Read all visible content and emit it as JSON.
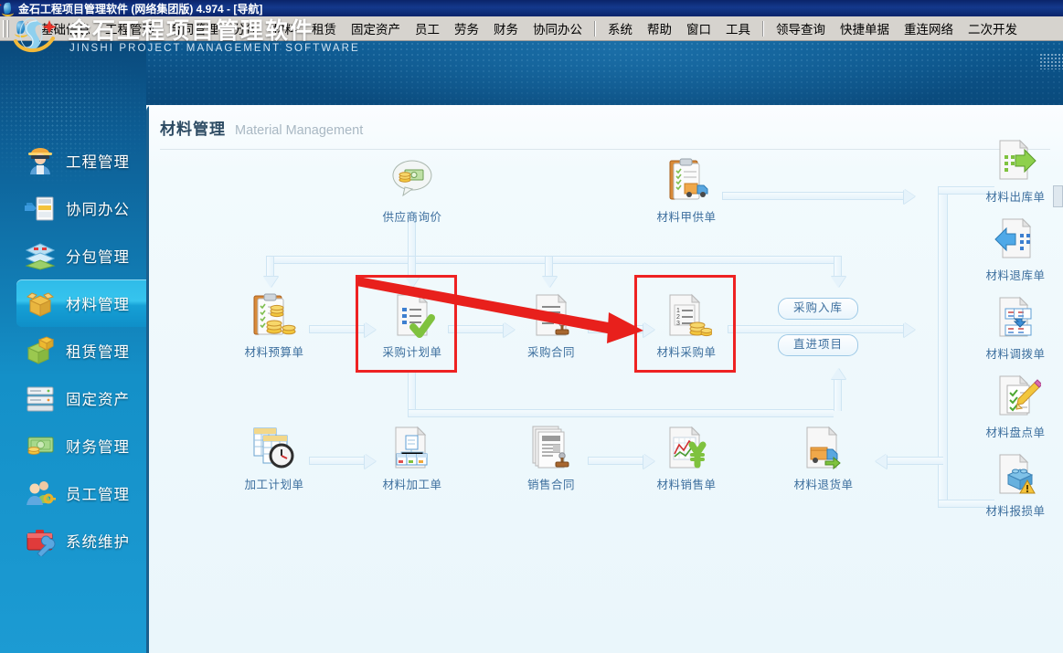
{
  "window": {
    "title": "金石工程项目管理软件 (网络集团版) 4.974 - [导航]",
    "icon": "app-logo-icon"
  },
  "menubar": {
    "items": [
      {
        "label": "基础信息"
      },
      {
        "label": "工程管理"
      },
      {
        "label": "合同管理"
      },
      {
        "label": "分包"
      },
      {
        "label": "材料"
      },
      {
        "label": "租赁"
      },
      {
        "label": "固定资产"
      },
      {
        "label": "员工"
      },
      {
        "label": "劳务"
      },
      {
        "label": "财务"
      },
      {
        "label": "协同办公"
      }
    ],
    "items2": [
      {
        "label": "系统"
      },
      {
        "label": "帮助"
      },
      {
        "label": "窗口"
      },
      {
        "label": "工具"
      }
    ],
    "items3": [
      {
        "label": "领导查询"
      },
      {
        "label": "快捷单据"
      },
      {
        "label": "重连网络"
      },
      {
        "label": "二次开发"
      }
    ]
  },
  "brand": {
    "cn": "金石工程项目管理软件",
    "en": "JINSHI PROJECT MANAGEMENT SOFTWARE"
  },
  "sidebar": {
    "items": [
      {
        "label": "工程管理",
        "icon": "worker-icon",
        "selected": false
      },
      {
        "label": "协同办公",
        "icon": "office-docs-icon",
        "selected": false
      },
      {
        "label": "分包管理",
        "icon": "layers-icon",
        "selected": false
      },
      {
        "label": "材料管理",
        "icon": "open-box-icon",
        "selected": true
      },
      {
        "label": "租赁管理",
        "icon": "green-cubes-icon",
        "selected": false
      },
      {
        "label": "固定资产",
        "icon": "server-rack-icon",
        "selected": false
      },
      {
        "label": "财务管理",
        "icon": "money-icon",
        "selected": false
      },
      {
        "label": "员工管理",
        "icon": "people-key-icon",
        "selected": false
      },
      {
        "label": "系统维护",
        "icon": "toolbox-wrench-icon",
        "selected": false
      }
    ]
  },
  "page": {
    "title_cn": "材料管理",
    "title_en": "Material Management"
  },
  "flow": {
    "nodes": [
      {
        "id": "supplier_quote",
        "label": "供应商询价",
        "icon": "price-quote-bubble-icon"
      },
      {
        "id": "owner_supply",
        "label": "材料甲供单",
        "icon": "clipboard-truck-icon"
      },
      {
        "id": "material_budget",
        "label": "材料预算单",
        "icon": "clipboard-coins-icon"
      },
      {
        "id": "purchase_plan",
        "label": "采购计划单",
        "icon": "doc-check-icon",
        "highlighted": true
      },
      {
        "id": "purchase_contract",
        "label": "采购合同",
        "icon": "doc-stamp-icon"
      },
      {
        "id": "purchase_order",
        "label": "材料采购单",
        "icon": "doc-list-coins-icon",
        "highlighted": true
      },
      {
        "id": "process_plan",
        "label": "加工计划单",
        "icon": "sheets-clock-icon"
      },
      {
        "id": "material_process",
        "label": "材料加工单",
        "icon": "doc-process-icon"
      },
      {
        "id": "sales_contract",
        "label": "销售合同",
        "icon": "docs-stamp-icon"
      },
      {
        "id": "material_sale",
        "label": "材料销售单",
        "icon": "doc-chart-yen-icon"
      },
      {
        "id": "material_return",
        "label": "材料退货单",
        "icon": "doc-truck-return-icon"
      },
      {
        "id": "stock_out",
        "label": "材料出库单",
        "icon": "doc-arrow-out-icon"
      },
      {
        "id": "stock_return",
        "label": "材料退库单",
        "icon": "doc-arrow-in-icon"
      },
      {
        "id": "stock_transfer",
        "label": "材料调拨单",
        "icon": "doc-transfer-icon"
      },
      {
        "id": "stock_count",
        "label": "材料盘点单",
        "icon": "doc-pencil-check-icon"
      },
      {
        "id": "stock_damage",
        "label": "材料报损单",
        "icon": "doc-box-warning-icon"
      }
    ],
    "pills": [
      {
        "id": "purchase_in",
        "label": "采购入库"
      },
      {
        "id": "direct_project",
        "label": "直进项目"
      }
    ]
  },
  "colors": {
    "accent": "#1490c8",
    "banner": "#0b4f83",
    "highlight": "#ee2222",
    "node_label": "#3d6f9e",
    "connector": "#cfe5f3"
  }
}
